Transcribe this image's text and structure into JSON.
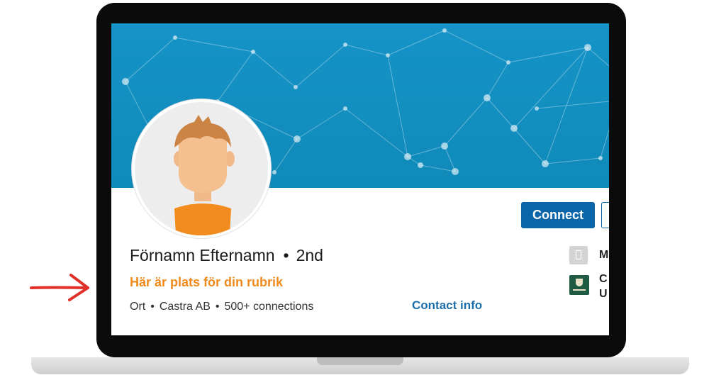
{
  "profile": {
    "name": "Förnamn Efternamn",
    "separator": "•",
    "degree": "2nd",
    "headline": "Här är plats för din rubrik",
    "location": "Ort",
    "company": "Castra AB",
    "connections": "500+ connections",
    "contact_info_label": "Contact info"
  },
  "actions": {
    "connect_label": "Connect"
  },
  "sidebar": {
    "company_text": "M",
    "school_line1": "C",
    "school_line2": "U"
  },
  "colors": {
    "banner": "#1693c7",
    "accent": "#0a66a8",
    "headline": "#ef8a1c"
  }
}
